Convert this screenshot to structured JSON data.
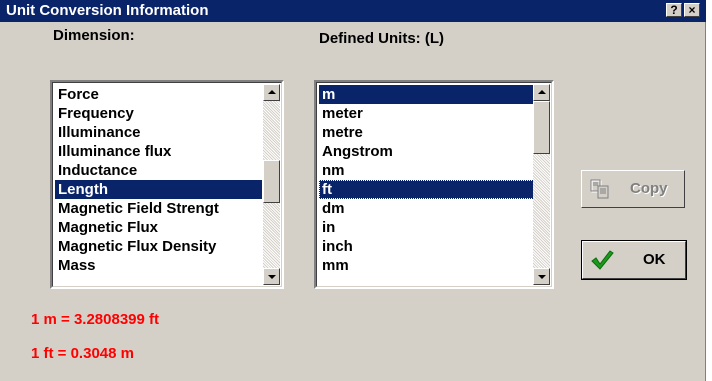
{
  "window": {
    "title": "Unit Conversion Information",
    "help_label": "?",
    "close_label": "×"
  },
  "dimension": {
    "label": "Dimension:",
    "items": [
      "Force",
      "Frequency",
      "Illuminance",
      "Illuminance flux",
      "Inductance",
      "Length",
      "Magnetic Field Strengt",
      "Magnetic Flux",
      "Magnetic Flux Density",
      "Mass"
    ],
    "selected": "Length"
  },
  "units": {
    "label": "Defined Units: (L)",
    "items": [
      "m",
      "meter",
      "metre",
      "Angstrom",
      "nm",
      "ft",
      "dm",
      "in",
      "inch",
      "mm"
    ],
    "selected": [
      "m",
      "ft"
    ]
  },
  "buttons": {
    "copy_label": "Copy",
    "ok_label": "OK"
  },
  "results": {
    "line1": "1 m = 3.2808399 ft",
    "line2": "1 ft = 0.3048 m"
  },
  "colors": {
    "title_bar": "#0a246a",
    "selection": "#0a246a",
    "result_text": "#ff0000",
    "check_green": "#1a9a1a"
  }
}
